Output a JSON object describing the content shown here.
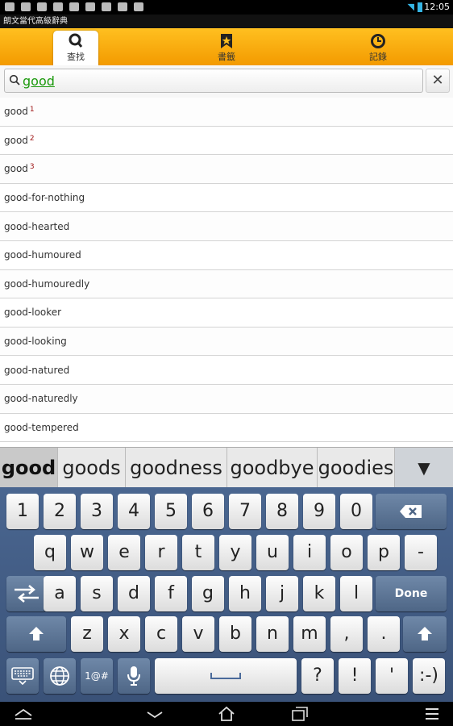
{
  "status_bar": {
    "time": "12:05"
  },
  "app": {
    "title": "朗文當代高級辭典"
  },
  "tabs": [
    {
      "label": "查找",
      "icon": "search-icon",
      "active": true
    },
    {
      "label": "書籤",
      "icon": "bookmark-star-icon",
      "active": false
    },
    {
      "label": "記錄",
      "icon": "history-clock-icon",
      "active": false
    }
  ],
  "search": {
    "value": "good",
    "clear_label": "✕"
  },
  "results": [
    {
      "word": "good",
      "sup": "1"
    },
    {
      "word": "good",
      "sup": "2"
    },
    {
      "word": "good",
      "sup": "3"
    },
    {
      "word": "good-for-nothing",
      "sup": ""
    },
    {
      "word": "good-hearted",
      "sup": ""
    },
    {
      "word": "good-humoured",
      "sup": ""
    },
    {
      "word": "good-humouredly",
      "sup": ""
    },
    {
      "word": "good-looker",
      "sup": ""
    },
    {
      "word": "good-looking",
      "sup": ""
    },
    {
      "word": "good-natured",
      "sup": ""
    },
    {
      "word": "good-naturedly",
      "sup": ""
    },
    {
      "word": "good-tempered",
      "sup": ""
    }
  ],
  "suggestions": [
    "good",
    "goods",
    "goodness",
    "goodbye",
    "goodies"
  ],
  "suggestion_expand": "▼",
  "keyboard": {
    "row1": [
      "1",
      "2",
      "3",
      "4",
      "5",
      "6",
      "7",
      "8",
      "9",
      "0"
    ],
    "row2": [
      "q",
      "w",
      "e",
      "r",
      "t",
      "y",
      "u",
      "i",
      "o",
      "p",
      "-"
    ],
    "row3": [
      "a",
      "s",
      "d",
      "f",
      "g",
      "h",
      "j",
      "k",
      "l"
    ],
    "row4": [
      "z",
      "x",
      "c",
      "v",
      "b",
      "n",
      "m",
      ",",
      "."
    ],
    "row5": [
      "?",
      "!",
      "'",
      ":-)"
    ],
    "done_label": "Done",
    "symbols_label": "1@#"
  }
}
